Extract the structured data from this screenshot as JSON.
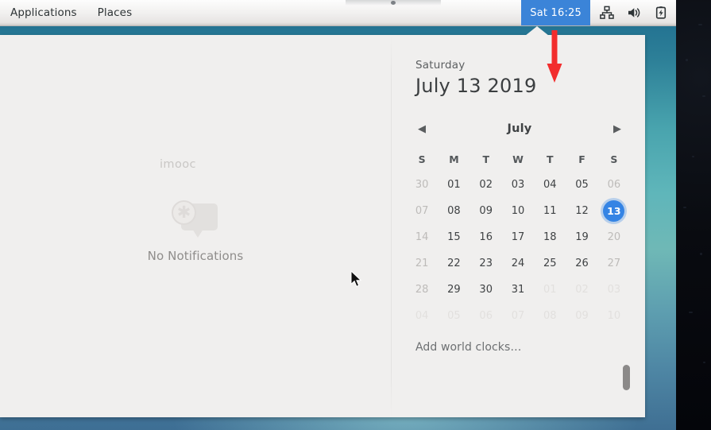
{
  "panel": {
    "menus": [
      {
        "name": "applications",
        "label": "Applications"
      },
      {
        "name": "places",
        "label": "Places"
      }
    ],
    "clock": "Sat 16:25",
    "tray": [
      {
        "name": "network-icon",
        "label": "network-icon"
      },
      {
        "name": "volume-icon",
        "label": "volume-icon"
      },
      {
        "name": "battery-charging-icon",
        "label": "battery-charging-icon"
      }
    ],
    "clock_bg": "#3584e4"
  },
  "notifications": {
    "watermark": "imooc",
    "empty_label": "No Notifications",
    "icon": "notification-bubble-icon"
  },
  "calendar": {
    "weekday": "Saturday",
    "full_date": "July 13 2019",
    "month": "July",
    "prev_label": "◀",
    "next_label": "▶",
    "daynames": [
      "S",
      "M",
      "T",
      "W",
      "T",
      "F",
      "S"
    ],
    "weeks": [
      [
        {
          "d": "30",
          "s": "dim"
        },
        {
          "d": "01",
          "s": ""
        },
        {
          "d": "02",
          "s": ""
        },
        {
          "d": "03",
          "s": ""
        },
        {
          "d": "04",
          "s": ""
        },
        {
          "d": "05",
          "s": ""
        },
        {
          "d": "06",
          "s": "dim"
        }
      ],
      [
        {
          "d": "07",
          "s": "dim"
        },
        {
          "d": "08",
          "s": ""
        },
        {
          "d": "09",
          "s": ""
        },
        {
          "d": "10",
          "s": ""
        },
        {
          "d": "11",
          "s": ""
        },
        {
          "d": "12",
          "s": ""
        },
        {
          "d": "13",
          "s": "today"
        }
      ],
      [
        {
          "d": "14",
          "s": "dim"
        },
        {
          "d": "15",
          "s": ""
        },
        {
          "d": "16",
          "s": ""
        },
        {
          "d": "17",
          "s": ""
        },
        {
          "d": "18",
          "s": ""
        },
        {
          "d": "19",
          "s": ""
        },
        {
          "d": "20",
          "s": "dim"
        }
      ],
      [
        {
          "d": "21",
          "s": "dim"
        },
        {
          "d": "22",
          "s": ""
        },
        {
          "d": "23",
          "s": ""
        },
        {
          "d": "24",
          "s": ""
        },
        {
          "d": "25",
          "s": ""
        },
        {
          "d": "26",
          "s": ""
        },
        {
          "d": "27",
          "s": "dim"
        }
      ],
      [
        {
          "d": "28",
          "s": "dim"
        },
        {
          "d": "29",
          "s": ""
        },
        {
          "d": "30",
          "s": ""
        },
        {
          "d": "31",
          "s": ""
        },
        {
          "d": "01",
          "s": "faint"
        },
        {
          "d": "02",
          "s": "faint"
        },
        {
          "d": "03",
          "s": "faint"
        }
      ],
      [
        {
          "d": "04",
          "s": "faint"
        },
        {
          "d": "05",
          "s": "faint"
        },
        {
          "d": "06",
          "s": "faint"
        },
        {
          "d": "07",
          "s": "faint"
        },
        {
          "d": "08",
          "s": "faint"
        },
        {
          "d": "09",
          "s": "faint"
        },
        {
          "d": "10",
          "s": "faint"
        }
      ]
    ],
    "world_clocks": "Add world clocks…",
    "today_color": "#3584e4"
  },
  "annotation": {
    "arrow": "red-down-arrow",
    "color": "#f22d2d"
  },
  "cursor": "mouse-pointer"
}
